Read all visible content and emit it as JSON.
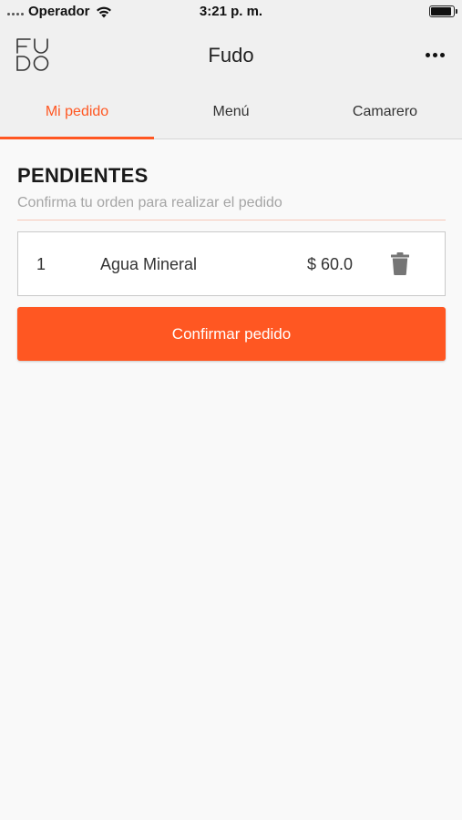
{
  "status_bar": {
    "carrier": "Operador",
    "time": "3:21 p. m.",
    "battery_level": 0.95
  },
  "header": {
    "title": "Fudo",
    "logo_text": "FUDO",
    "more_icon": "more-horizontal-icon"
  },
  "tabs": [
    {
      "label": "Mi pedido",
      "active": true
    },
    {
      "label": "Menú",
      "active": false
    },
    {
      "label": "Camarero",
      "active": false
    }
  ],
  "pending": {
    "title": "PENDIENTES",
    "subtitle": "Confirma tu orden para realizar el pedido",
    "items": [
      {
        "quantity": "1",
        "name": "Agua Mineral",
        "price": "$ 60.0",
        "delete_icon": "trash-icon"
      }
    ],
    "confirm_label": "Confirmar pedido"
  },
  "colors": {
    "accent": "#ff5722",
    "background": "#f9f9f9",
    "header_bg": "#f0f0f0"
  }
}
